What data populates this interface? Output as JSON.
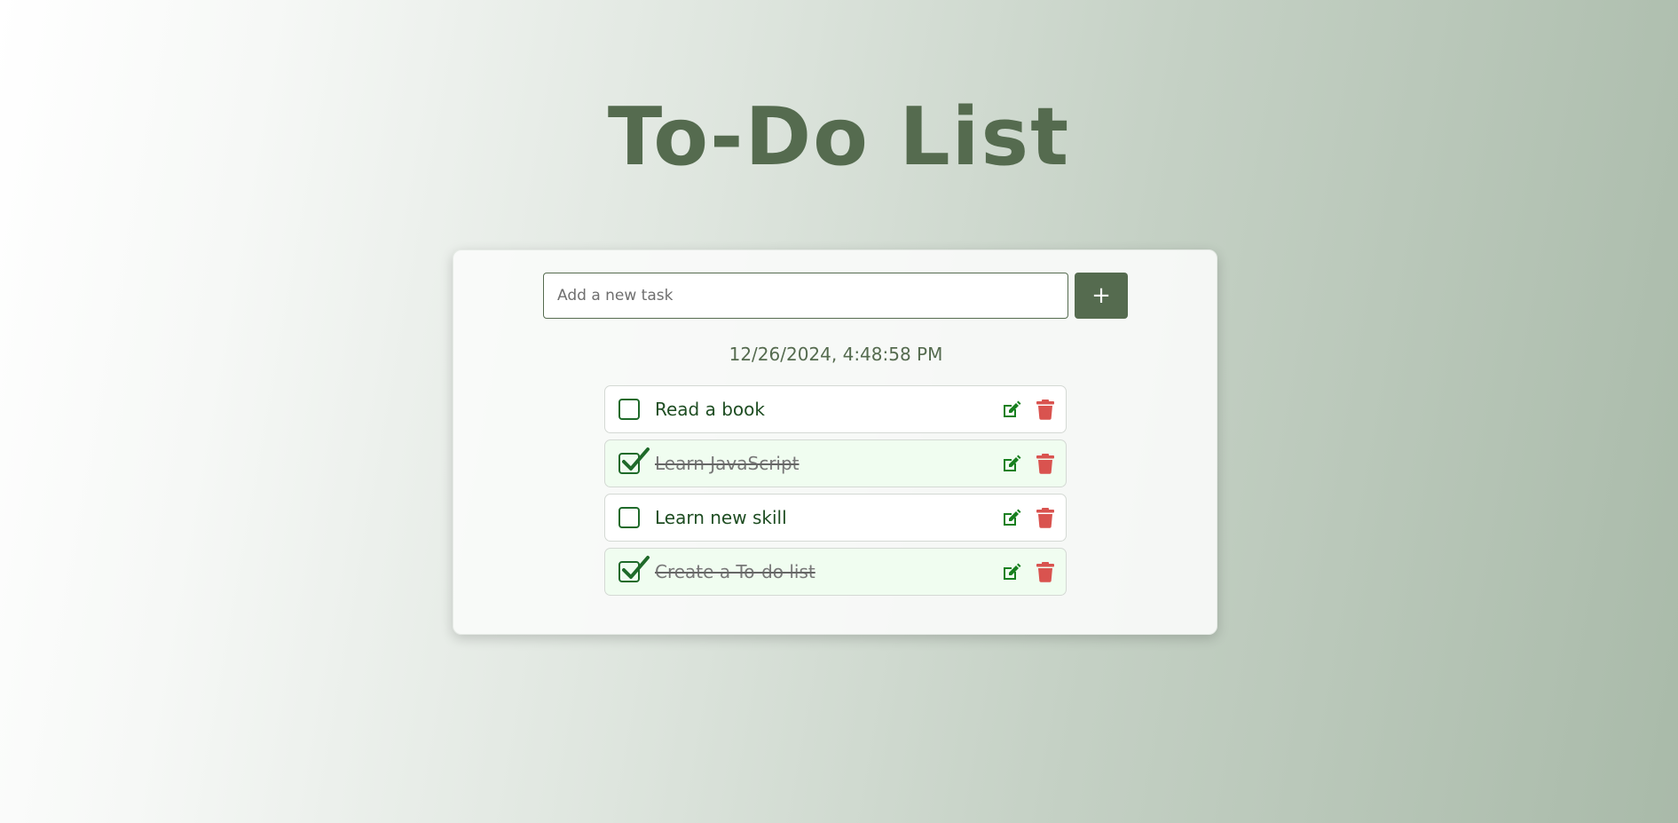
{
  "app": {
    "title": "To-Do List"
  },
  "input": {
    "placeholder": "Add a new task",
    "value": ""
  },
  "add_button": {
    "label": "+"
  },
  "datetime": "12/26/2024, 4:48:58 PM",
  "tasks": [
    {
      "text": "Read a book",
      "completed": false
    },
    {
      "text": "Learn JavaScript",
      "completed": true
    },
    {
      "text": "Learn new skill",
      "completed": false
    },
    {
      "text": "Create a To-do list",
      "completed": true
    }
  ],
  "icons": {
    "edit": "edit-icon",
    "delete": "trash-icon",
    "check": "checkmark-icon"
  },
  "colors": {
    "primary": "#556b4f",
    "task_text": "#1e4d22",
    "edit_icon": "#18801f",
    "delete_icon": "#d9534f",
    "done_background": "#f0fdf0"
  }
}
